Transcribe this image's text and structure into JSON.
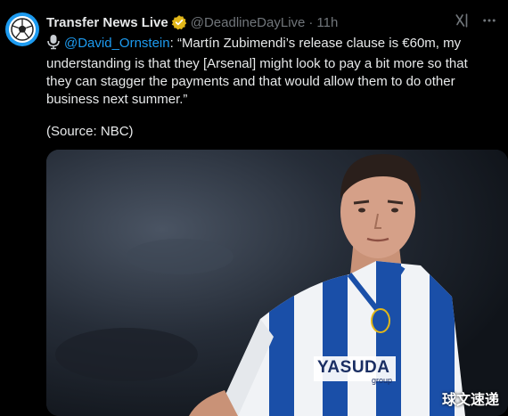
{
  "tweet": {
    "display_name": "Transfer News Live",
    "handle": "@DeadlineDayLive",
    "separator": "·",
    "time": "11h",
    "mention": "@David_Ornstein",
    "text_after_mention": ": “Martín Zubimendi’s release clause is €60m, my understanding is that they [Arsenal] might look to pay a bit more so that they can stagger the payments and that would allow them to do other business next summer.”",
    "source": "(Source: NBC)"
  },
  "photo": {
    "jersey_sponsor": "YASUDA",
    "jersey_sponsor_sub": "group",
    "watermark": "球文速递"
  },
  "icons": {
    "avatar": "football-icon",
    "verified": "verified-badge-icon",
    "grok": "grok-icon",
    "more": "more-icon",
    "mic": "microphone-icon"
  },
  "colors": {
    "accent": "#1d9bf0",
    "verified_gold": "#e2b719",
    "muted": "#71767b",
    "jersey_blue": "#1a4fa8"
  }
}
